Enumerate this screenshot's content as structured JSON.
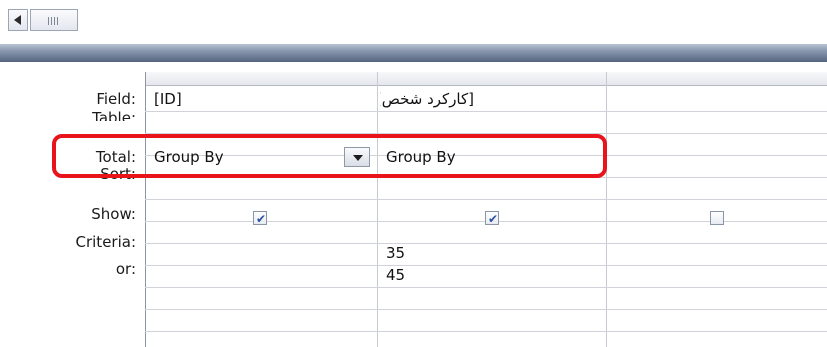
{
  "scrollbar": {
    "left_arrow_icon": "left-arrow",
    "thumb_icon": "grip"
  },
  "rows": {
    "field": "Field:",
    "table": "Table:",
    "total": "Total:",
    "sort": "Sort:",
    "show": "Show:",
    "criteria": "Criteria:",
    "or": "or:"
  },
  "columns": [
    {
      "field": "[ID]",
      "table": "... ...",
      "total": "Group By",
      "show": true,
      "criteria": "",
      "or": ""
    },
    {
      "field": "[کارکرد شخص]",
      "table": "... ...",
      "total": "Group By",
      "show": true,
      "criteria": "35",
      "or": "45"
    },
    {
      "field": "",
      "table": "",
      "total": "",
      "show": false,
      "criteria": "",
      "or": ""
    }
  ],
  "colors": {
    "highlight": "#e8131b",
    "separator": "#6b7b96"
  }
}
